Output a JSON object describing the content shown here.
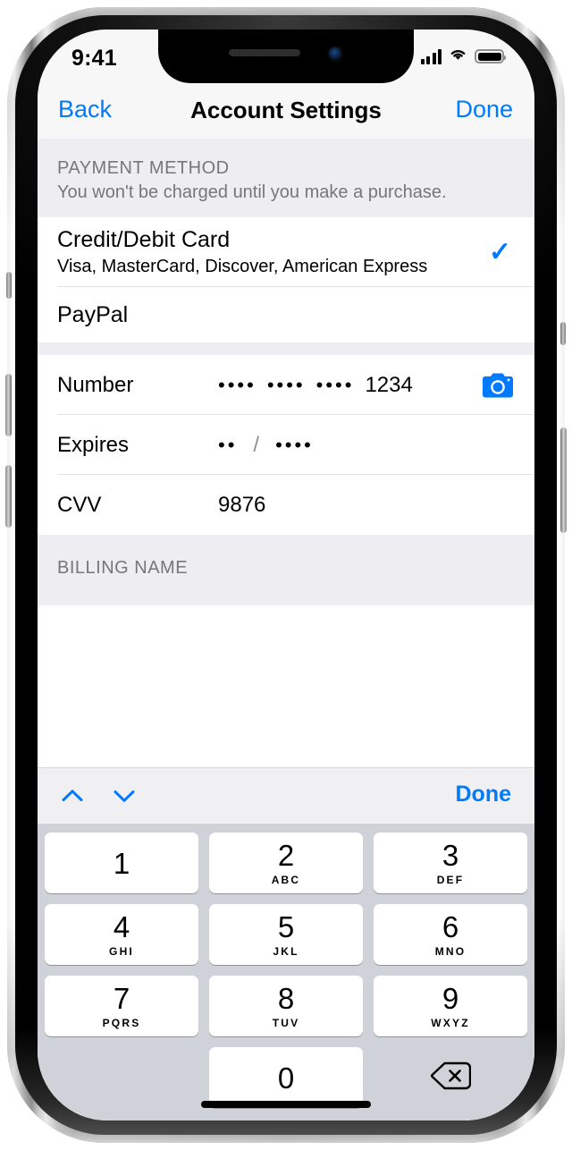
{
  "status_bar": {
    "time": "9:41",
    "signal_icon": "cellular-signal-icon",
    "wifi_icon": "wifi-icon",
    "battery_icon": "battery-icon"
  },
  "nav_bar": {
    "back_label": "Back",
    "title": "Account Settings",
    "done_label": "Done"
  },
  "payment_method_section": {
    "header": "PAYMENT METHOD",
    "subheader": "You won't be charged until you make a purchase.",
    "options": [
      {
        "title": "Credit/Debit Card",
        "subtitle": "Visa, MasterCard, Discover, American Express",
        "selected": true,
        "check_glyph": "✓"
      },
      {
        "title": "PayPal",
        "subtitle": "",
        "selected": false,
        "check_glyph": ""
      }
    ]
  },
  "card_fields": [
    {
      "label": "Number",
      "value_masked": "•••• •••• •••• 1234",
      "group1": "••••",
      "group2": "••••",
      "group3": "••••",
      "group4": "1234",
      "accessory_icon": "camera-icon"
    },
    {
      "label": "Expires",
      "month_masked": "••",
      "separator": "/",
      "year_masked": "••••"
    },
    {
      "label": "CVV",
      "value": "9876"
    }
  ],
  "billing_section": {
    "header": "BILLING NAME"
  },
  "keyboard": {
    "toolbar": {
      "prev_icon": "chevron-up-icon",
      "next_icon": "chevron-down-icon",
      "done_label": "Done"
    },
    "rows": [
      [
        {
          "num": "1",
          "letters": ""
        },
        {
          "num": "2",
          "letters": "ABC"
        },
        {
          "num": "3",
          "letters": "DEF"
        }
      ],
      [
        {
          "num": "4",
          "letters": "GHI"
        },
        {
          "num": "5",
          "letters": "JKL"
        },
        {
          "num": "6",
          "letters": "MNO"
        }
      ],
      [
        {
          "num": "7",
          "letters": "PQRS"
        },
        {
          "num": "8",
          "letters": "TUV"
        },
        {
          "num": "9",
          "letters": "WXYZ"
        }
      ],
      [
        {
          "num": "",
          "letters": ""
        },
        {
          "num": "0",
          "letters": ""
        },
        {
          "num": "",
          "letters": "",
          "icon": "backspace-icon"
        }
      ]
    ]
  },
  "colors": {
    "accent_blue": "#007aff",
    "group_header_gray": "#eeeef2",
    "keyboard_bg": "#cfd2d8",
    "key_white": "#ffffff",
    "separator": "#e2e2e4",
    "secondary_text": "#76767b"
  },
  "home_indicator": "home-indicator"
}
